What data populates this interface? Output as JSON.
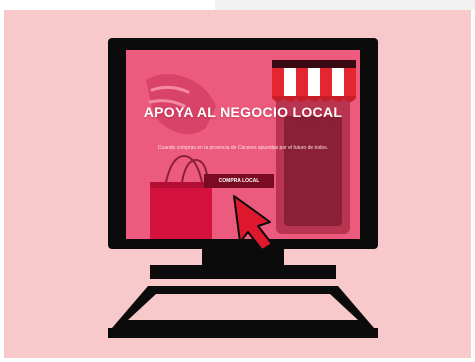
{
  "illustration": {
    "headline": "APOYA AL NEGOCIO LOCAL",
    "subtext": "Cuando compras en la provincia de Cáceres apuestas por el futuro de todos.",
    "cta_label": "COMPRA LOCAL"
  },
  "colors": {
    "background": "#f8c9cb",
    "monitor": "#0b0b0b",
    "screen": "#ec5b7e",
    "cta": "#7a0b22",
    "awning_red": "#e4262f",
    "awning_white": "#ffffff",
    "arrow": "#e0182d"
  },
  "icons": [
    "shopping-bag-icon",
    "hand-icon",
    "store-awning-icon",
    "cursor-arrow-icon"
  ]
}
